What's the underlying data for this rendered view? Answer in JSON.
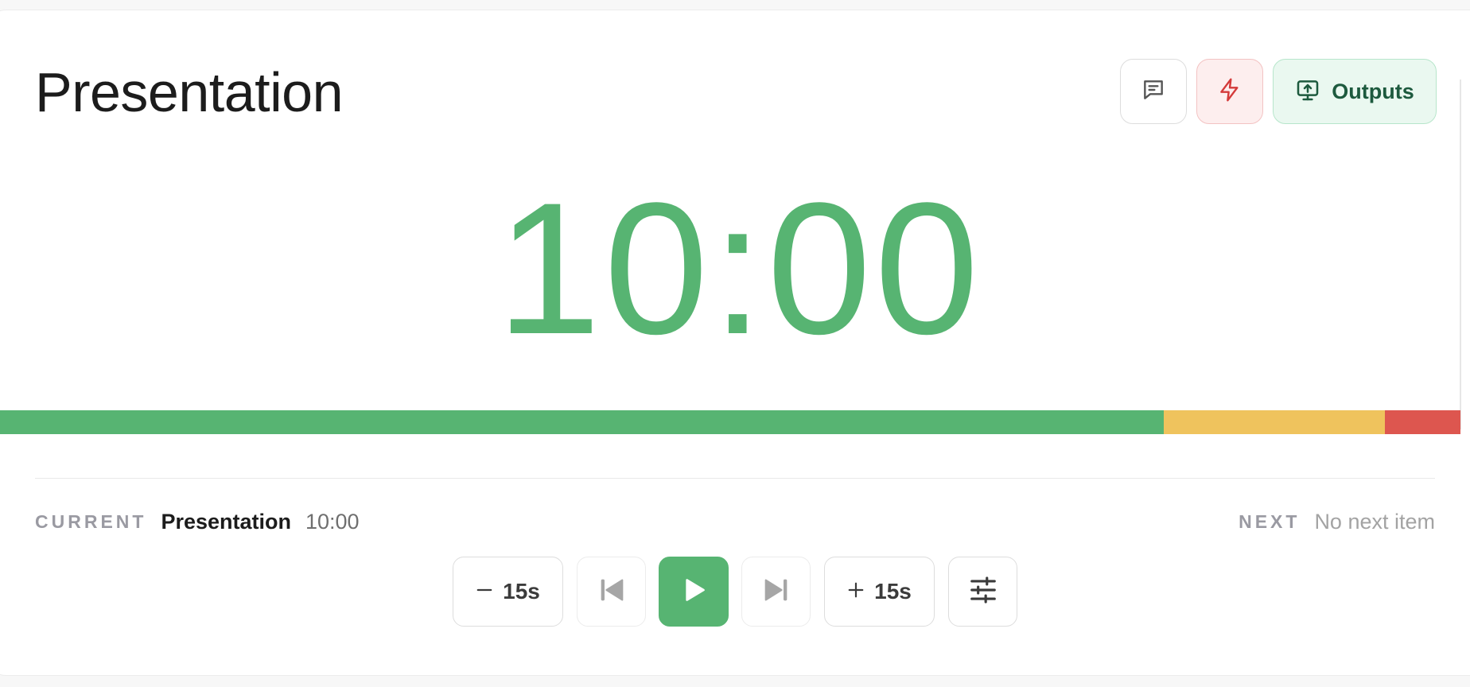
{
  "header": {
    "title": "Presentation",
    "buttons": {
      "notes_icon": "message-square-icon",
      "flash_icon": "zap-icon",
      "outputs_icon": "monitor-upload-icon",
      "outputs_label": "Outputs"
    }
  },
  "timer": {
    "display": "10:00",
    "color": "#57b472"
  },
  "progress": {
    "segments": [
      {
        "name": "green",
        "fraction": 0.797,
        "color": "#57b472"
      },
      {
        "name": "yellow",
        "fraction": 0.151,
        "color": "#efc35d"
      },
      {
        "name": "red",
        "fraction": 0.052,
        "color": "#dd564f"
      }
    ]
  },
  "info": {
    "current_label": "CURRENT",
    "current_name": "Presentation",
    "current_duration": "10:00",
    "next_label": "NEXT",
    "next_value": "No next item"
  },
  "controls": {
    "minus_label": "15s",
    "plus_label": "15s",
    "minus_icon": "minus-icon",
    "plus_icon": "plus-icon",
    "prev_icon": "skip-back-icon",
    "play_icon": "play-icon",
    "next_icon": "skip-forward-icon",
    "settings_icon": "sliders-icon"
  },
  "colors": {
    "accent_green": "#57b472",
    "warning_yellow": "#efc35d",
    "danger_red": "#dd564f",
    "outputs_text": "#1d5a3e"
  }
}
